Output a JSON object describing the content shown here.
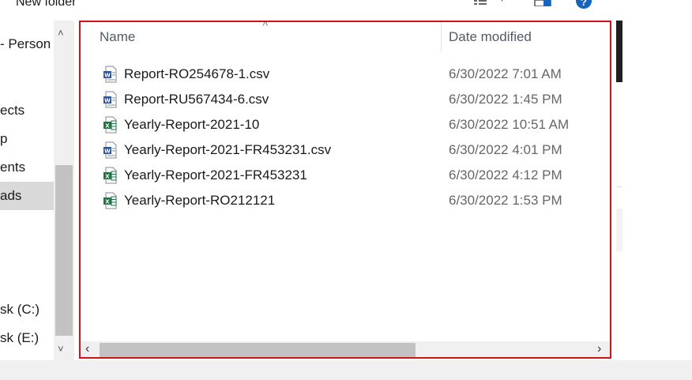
{
  "toolbar": {
    "new_folder_label": "New folder",
    "view_icon": "details-view-icon",
    "dropdown_icon": "chevron-down-icon",
    "preview_icon": "preview-pane-icon",
    "help_icon": "help-icon",
    "help_glyph": "?",
    "help_color": "#1565c0"
  },
  "nav": {
    "items": [
      {
        "label": "- Person",
        "selected": false
      },
      {
        "label": "ects",
        "selected": false
      },
      {
        "label": "p",
        "selected": false
      },
      {
        "label": "ents",
        "selected": false
      },
      {
        "label": "ads",
        "selected": true
      },
      {
        "label": "sk (C:)",
        "selected": false
      },
      {
        "label": "sk (E:)",
        "selected": false
      }
    ],
    "scroll_up": "˄",
    "scroll_down": "˅"
  },
  "file_list": {
    "sort_indicator": "˄",
    "columns": {
      "name": "Name",
      "date_modified": "Date modified"
    },
    "highlight_color": "#d0121b",
    "rows": [
      {
        "name": "Report-RO254678-1.csv",
        "date": "6/30/2022 7:01 AM",
        "icon": "word-file-icon"
      },
      {
        "name": "Report-RU567434-6.csv",
        "date": "6/30/2022 1:45 PM",
        "icon": "word-file-icon"
      },
      {
        "name": "Yearly-Report-2021-10",
        "date": "6/30/2022 10:51 AM",
        "icon": "excel-file-icon"
      },
      {
        "name": "Yearly-Report-2021-FR453231.csv",
        "date": "6/30/2022 4:01 PM",
        "icon": "word-file-icon"
      },
      {
        "name": "Yearly-Report-2021-FR453231",
        "date": "6/30/2022 4:12 PM",
        "icon": "excel-file-icon"
      },
      {
        "name": "Yearly-Report-RO212121",
        "date": "6/30/2022 1:53 PM",
        "icon": "excel-file-icon"
      }
    ],
    "scroll_left": "‹",
    "scroll_right": "›"
  },
  "colors": {
    "word_blue": "#2b579a",
    "excel_green": "#217346"
  }
}
